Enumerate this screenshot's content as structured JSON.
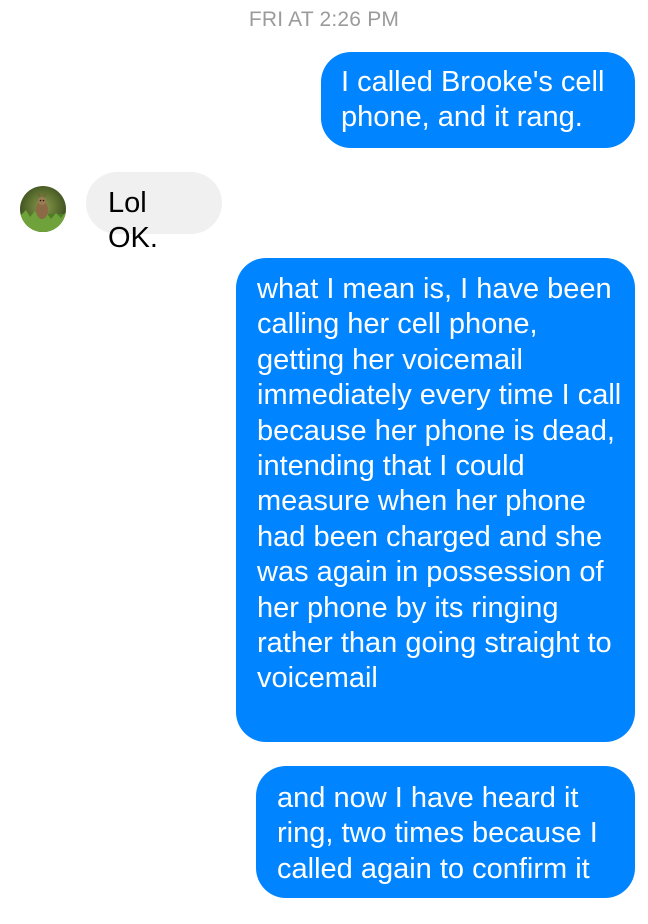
{
  "conversation": {
    "timestamp": "FRI AT 2:26 PM",
    "messages": [
      {
        "sender": "me",
        "text": "I called Brooke's cell phone, and it rang."
      },
      {
        "sender": "contact",
        "text": "Lol OK."
      },
      {
        "sender": "me",
        "text": "what I mean is, I have been calling her cell phone, getting her voicemail immediately every time I call because her phone is dead, intending that I could measure when her phone had been charged and she was again in possession of her phone by its ringing rather than going straight to voicemail"
      },
      {
        "sender": "me",
        "text": "and now I have heard it ring, two times because I called again to confirm it"
      }
    ]
  },
  "colors": {
    "outgoing_bubble": "#0084ff",
    "incoming_bubble": "#f1f0f0",
    "timestamp_text": "#9b9b9b"
  },
  "icons": {
    "contact_avatar": "contact-avatar-photo"
  }
}
